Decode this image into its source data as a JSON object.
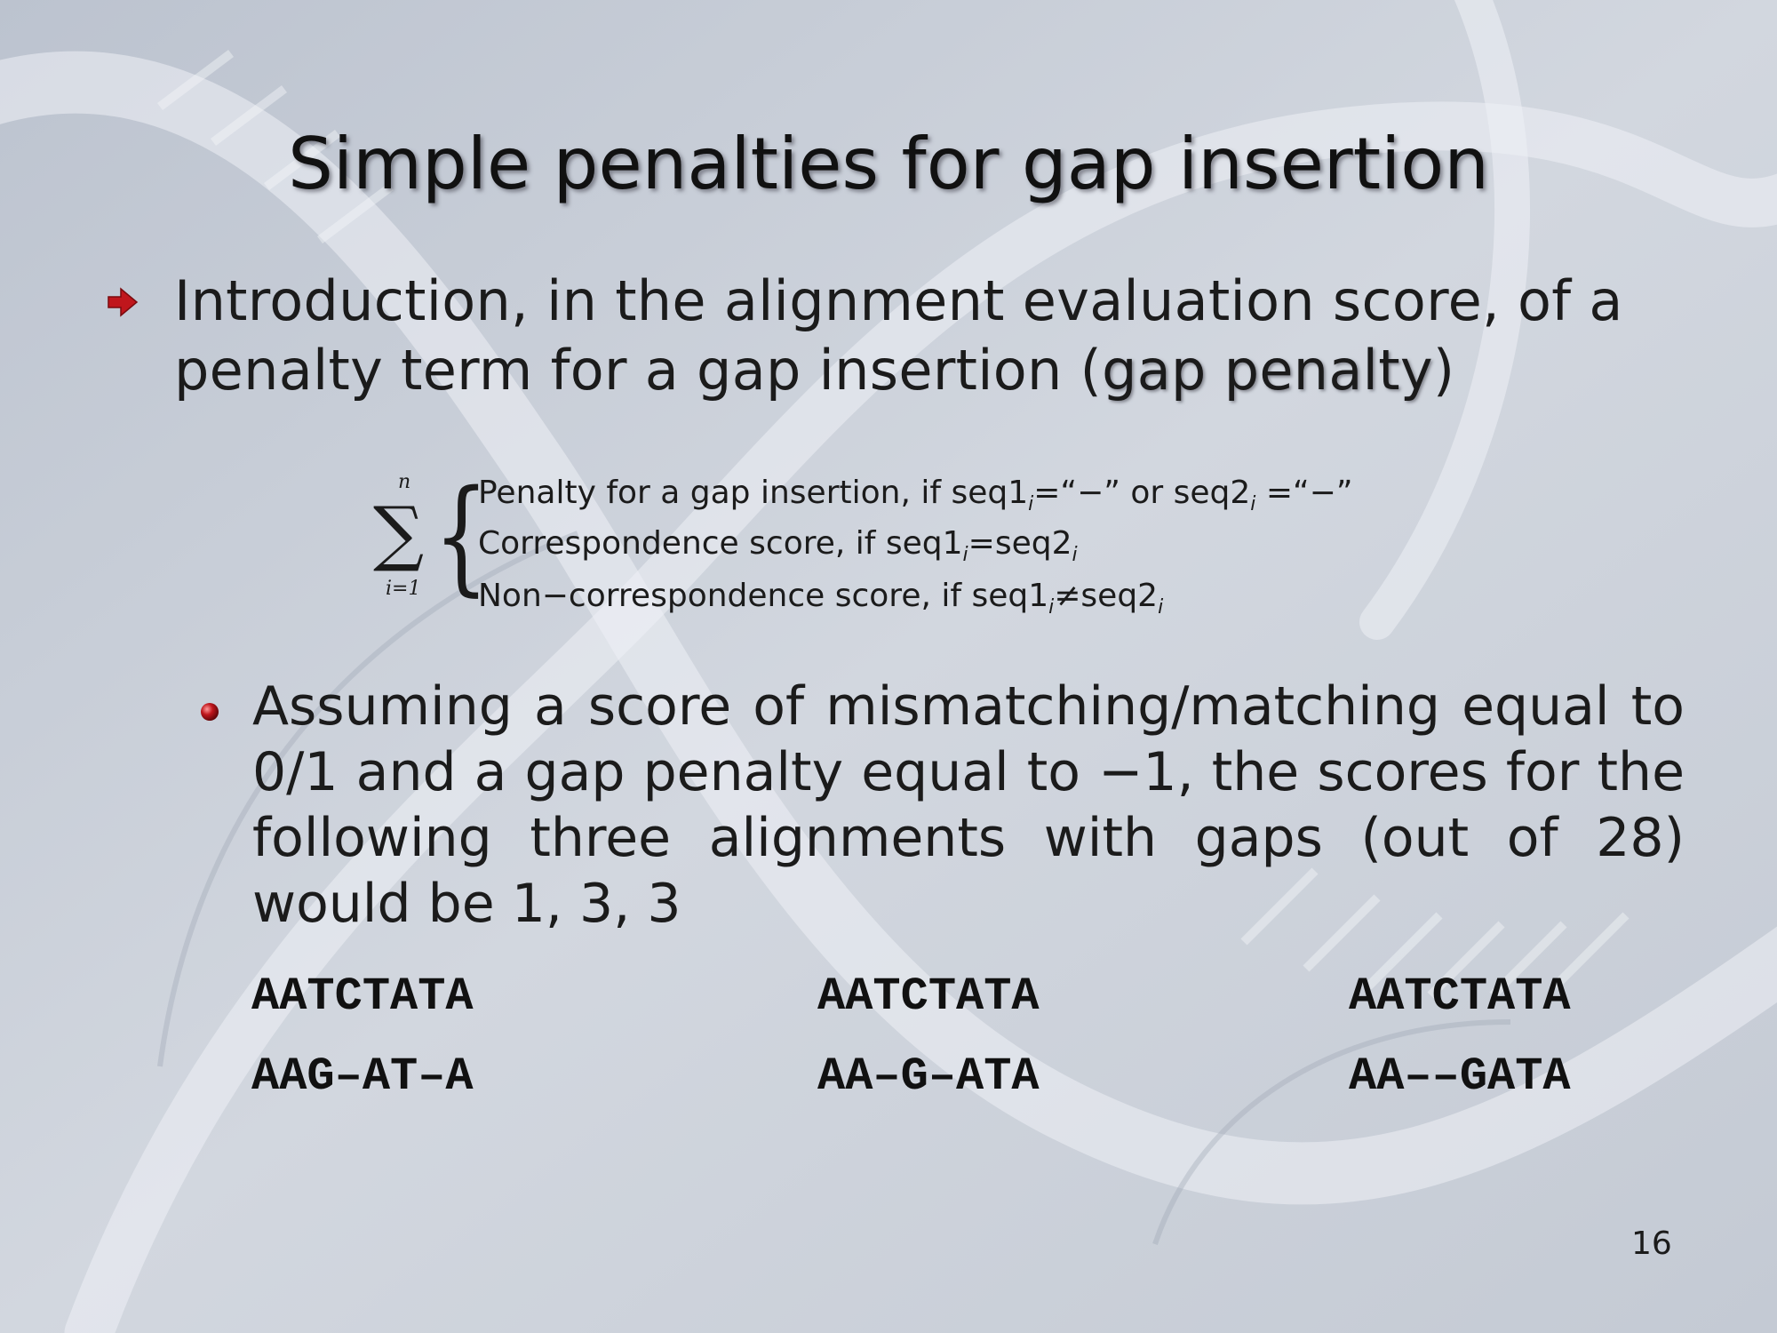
{
  "slide": {
    "title": "Simple penalties for gap insertion",
    "bullet1_text": "Introduction, in the alignment evaluation score, of a penalty term for a gap insertion (",
    "bullet1_term": "gap penalty",
    "bullet1_end": ")",
    "formula": {
      "sum_symbol": "∑",
      "upper": "n",
      "lower": "i=1",
      "brace": "{",
      "cases": [
        {
          "pre": "Penalty for a gap insertion, if seq1",
          "sub1": "i",
          "mid": "=“−” or seq2",
          "sub2": "i",
          "post": " =“−”"
        },
        {
          "pre": "Correspondence score, if seq1",
          "sub1": "i",
          "mid": "=seq2",
          "sub2": "i",
          "post": ""
        },
        {
          "pre": "Non−correspondence score, if seq1",
          "sub1": "i",
          "mid": "≠seq2",
          "sub2": "i",
          "post": ""
        }
      ]
    },
    "bullet2_text": "Assuming a score of mismatching/matching equal to 0/1 and a gap penalty equal to −1, the scores for the following three alignments with gaps (out of 28) would be 1, 3, 3",
    "alignments": [
      {
        "top": "AATCTATA",
        "bottom": "AAG–AT–A"
      },
      {
        "top": "AATCTATA",
        "bottom": "AA–G–ATA"
      },
      {
        "top": "AATCTATA",
        "bottom": "AA––GATA"
      }
    ],
    "page_number": "16"
  },
  "colors": {
    "background": "#c9cfd9",
    "bullet_accent": "#c0161c",
    "text": "#1b1b1b"
  },
  "icons": {
    "bullet1": "red-arrow-icon",
    "bullet2": "red-ball-icon"
  }
}
